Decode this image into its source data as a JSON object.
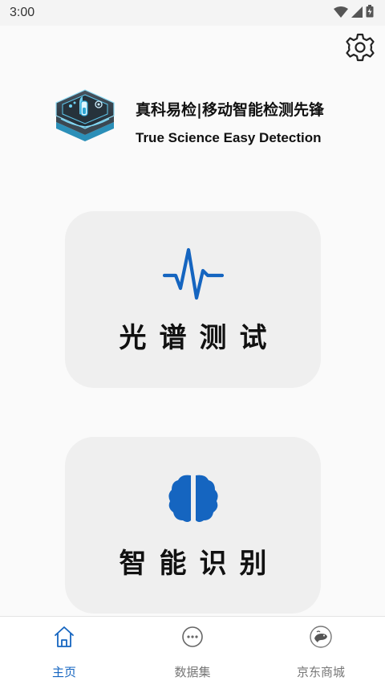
{
  "status_bar": {
    "time": "3:00",
    "icons": [
      "wifi-icon",
      "signal-icon",
      "battery-icon"
    ]
  },
  "header": {
    "settings_icon": "gear-icon"
  },
  "brand": {
    "title": "真科易检|移动智能检测先锋",
    "subtitle": "True Science Easy Detection"
  },
  "features": [
    {
      "label": "光谱测试",
      "icon": "waveform-icon",
      "color": "#1565c0"
    },
    {
      "label": "智能识别",
      "icon": "brain-icon",
      "color": "#1565c0"
    }
  ],
  "bottom_nav": {
    "items": [
      {
        "label": "主页",
        "icon": "home-icon",
        "active": true
      },
      {
        "label": "数据集",
        "icon": "dataset-icon",
        "active": false
      },
      {
        "label": "京东商城",
        "icon": "jd-mall-icon",
        "active": false
      }
    ]
  },
  "colors": {
    "accent": "#1565c0",
    "card_bg": "#efefef",
    "page_bg": "#fafafa"
  }
}
